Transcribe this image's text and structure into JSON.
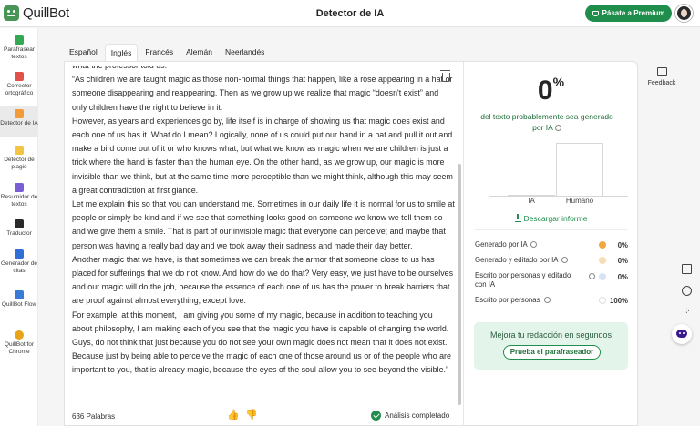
{
  "app": {
    "name": "QuillBot",
    "page_title": "Detector de IA",
    "premium_label": "Pásate a Premium"
  },
  "sidebar": {
    "items": [
      {
        "label": "Parafrasear textos",
        "color": "#34a853"
      },
      {
        "label": "Corrector ortográfico",
        "color": "#e0524a"
      },
      {
        "label": "Detector de IA",
        "color": "#f29b38",
        "active": true
      },
      {
        "label": "Detector de plagio",
        "color": "#f4c542"
      },
      {
        "label": "Resumidor de textos",
        "color": "#7b5ed6"
      },
      {
        "label": "Traductor",
        "color": "#2a2a2a"
      },
      {
        "label": "Generador de citas",
        "color": "#2f6fd6"
      },
      {
        "label": "QuillBot Flow",
        "color": "#3a7bd5"
      },
      {
        "label": "QuillBot for Chrome",
        "color": "#e8a317"
      }
    ]
  },
  "tabs": [
    "Español",
    "Inglés",
    "Francés",
    "Alemán",
    "Neerlandés"
  ],
  "editor": {
    "paragraphs": [
      "what the professor told us:",
      "“As children we are taught magic as those non-normal things that happen, like a rose appearing in a hat or someone disappearing and reappearing. Then as we grow up we realize that magic “doesn't exist” and only children have the right to believe in it.",
      "However, as years and experiences go by, life itself is in charge of showing us that magic does exist and each one of us has it. What do I mean? Logically, none of us could put our hand in a hat and pull it out and make a bird come out of it or who knows what, but what we know as magic when we are children is just a trick where the hand is faster than the human eye. On the other hand, as we grow up, our magic is more invisible than we think, but at the same time more perceptible than we might think, although this may seem a great contradiction at first glance.",
      "Let me explain this so that you can understand me. Sometimes in our daily life it is normal for us to smile at people or simply be kind and if we see that something looks good on someone we know we tell them so and we give them a smile. That is part of our invisible magic that everyone can perceive; and maybe that person was having a really bad day and we took away their sadness and made their day better.",
      "Another magic that we have, is that sometimes we can break the armor that someone close to us has placed for sufferings that we do not know. And how do we do that? Very easy, we just have to be ourselves and our magic will do the job, because the essence of each one of us has the power to break barriers that are proof against almost everything, except love.",
      "For example, at this moment, I am giving you some of my magic, because in addition to teaching you about philosophy, I am making each of you see that the magic you have is capable of changing the world. Guys, do not think that just because you do not see your own magic does not mean that it does not exist. Because just by being able to perceive the magic of each one of those around us or of the people who are important to you, that is already magic, because the eyes of the soul allow you to see beyond the visible.”"
    ],
    "word_count": "636 Palabras",
    "status": "Análisis completado"
  },
  "results": {
    "percent": "0",
    "percent_sign": "%",
    "description": "del texto probablemente sea generado por IA",
    "chart_labels": [
      "IA",
      "Humano"
    ],
    "download_label": "Descargar informe",
    "stats": [
      {
        "label": "Generado por IA",
        "value": "0%",
        "color": "#f2a641"
      },
      {
        "label": "Generado y editado por IA",
        "value": "0%",
        "color": "#f7dcb4"
      },
      {
        "label": "Escrito por personas y editado con IA",
        "value": "0%",
        "color": "#d7e2f6"
      },
      {
        "label": "Escrito por personas",
        "value": "100%",
        "color": "#ffffff"
      }
    ],
    "promo_text": "Mejora tu redacción en segundos",
    "promo_button": "Prueba el parafraseador"
  },
  "rail": {
    "feedback_label": "Feedback"
  }
}
